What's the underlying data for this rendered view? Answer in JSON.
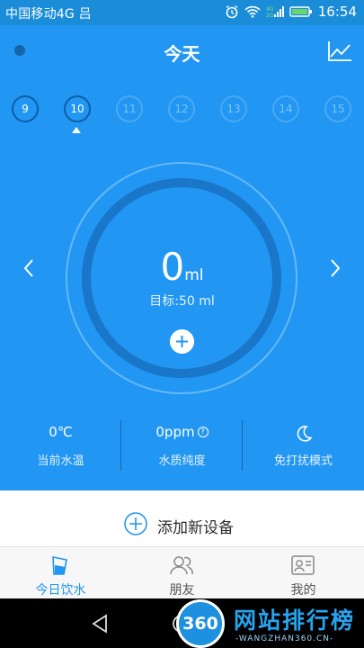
{
  "status_bar": {
    "carrier": "中国移动4G 吕",
    "time": "16:54"
  },
  "header": {
    "title": "今天"
  },
  "dates": [
    {
      "label": "9",
      "state": "past"
    },
    {
      "label": "10",
      "state": "selected"
    },
    {
      "label": "11",
      "state": "future"
    },
    {
      "label": "12",
      "state": "future"
    },
    {
      "label": "13",
      "state": "future"
    },
    {
      "label": "14",
      "state": "future"
    },
    {
      "label": "15",
      "state": "future"
    }
  ],
  "intake": {
    "amount": "0",
    "unit": "ml",
    "goal": "目标:50 ml"
  },
  "stats": [
    {
      "value": "0℃",
      "label": "当前水温"
    },
    {
      "value": "0ppm",
      "label": "水质纯度"
    },
    {
      "value": "",
      "label": "免打扰模式"
    }
  ],
  "add_device": {
    "label": "添加新设备"
  },
  "bottom_nav": [
    {
      "label": "今日饮水",
      "active": true
    },
    {
      "label": "朋友",
      "active": false
    },
    {
      "label": "我的",
      "active": false
    }
  ],
  "watermark": {
    "badge": "360",
    "title": "网站排行榜",
    "subtitle": "-WANGZHAN360.CN-"
  },
  "colors": {
    "primary": "#2196f3",
    "ring": "#1976c8",
    "status_bar": "#1a8cd8"
  }
}
